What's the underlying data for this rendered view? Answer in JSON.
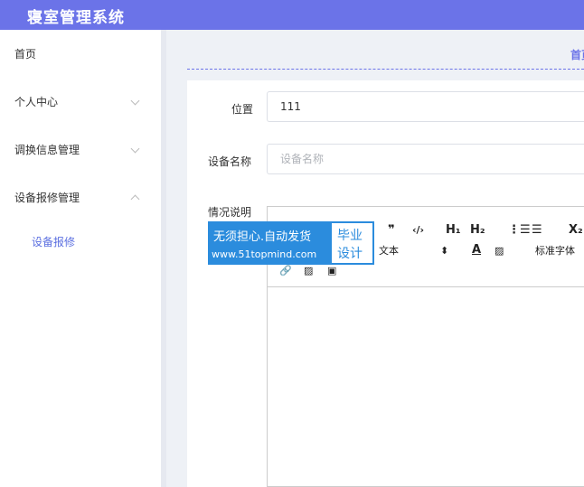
{
  "app": {
    "title": "寝室管理系统"
  },
  "sidebar": {
    "items": [
      {
        "label": "首页"
      },
      {
        "label": "个人中心"
      },
      {
        "label": "调换信息管理"
      },
      {
        "label": "设备报修管理"
      }
    ],
    "sub_items": [
      {
        "label": "设备报修"
      }
    ]
  },
  "breadcrumb": {
    "first": "首页"
  },
  "form": {
    "location": {
      "label": "位置",
      "value": "111"
    },
    "device_name": {
      "label": "设备名称",
      "placeholder": "设备名称"
    },
    "description": {
      "label": "情况说明"
    }
  },
  "editor": {
    "toolbar": {
      "quote": "❞",
      "code": "‹/›",
      "h1": "H₁",
      "h2": "H₂",
      "ordered_list": "⋮☰",
      "bullet_list": "☰",
      "subscript": "X₂",
      "text_type": "文本",
      "text_type_arrow": "⬍",
      "font_color": "A",
      "background_color": "▨",
      "font_family": "标准字体",
      "link": "🔗",
      "image": "▨",
      "video": "▣"
    }
  },
  "watermark": {
    "slogan": "无须担心.自动发货",
    "site": "www.51topmind.com",
    "badge_line1": "毕业",
    "badge_line2": "设计"
  }
}
